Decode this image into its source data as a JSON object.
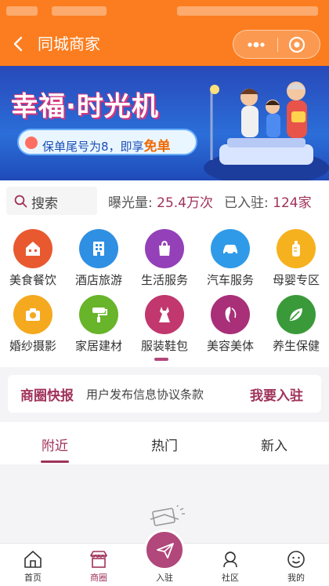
{
  "header": {
    "title": "同城商家",
    "background": "#fb7d1f"
  },
  "banner": {
    "title": "幸福·时光机",
    "subtitle_prefix": "保单尾号为8，即享",
    "subtitle_highlight": "免单"
  },
  "stats": {
    "search_label": "搜索",
    "exposure_label": "曝光量:",
    "exposure_value": "25.4万次",
    "joined_label": "已入驻:",
    "joined_value": "124家"
  },
  "categories": [
    {
      "label": "美食餐饮",
      "icon": "house-icon",
      "color": "#e8592f"
    },
    {
      "label": "酒店旅游",
      "icon": "hotel-icon",
      "color": "#2f8fe2"
    },
    {
      "label": "生活服务",
      "icon": "bag-icon",
      "color": "#9440b8"
    },
    {
      "label": "汽车服务",
      "icon": "car-icon",
      "color": "#2f9be8"
    },
    {
      "label": "母婴专区",
      "icon": "bottle-icon",
      "color": "#f5b21e"
    },
    {
      "label": "婚纱摄影",
      "icon": "camera-icon",
      "color": "#f5a91e"
    },
    {
      "label": "家居建材",
      "icon": "roller-icon",
      "color": "#68b42a"
    },
    {
      "label": "服装鞋包",
      "icon": "dress-icon",
      "color": "#c1376e"
    },
    {
      "label": "美容美体",
      "icon": "face-icon",
      "color": "#a82f78"
    },
    {
      "label": "养生保健",
      "icon": "leaf-icon",
      "color": "#3a9a3a"
    }
  ],
  "news": {
    "tag": "商圈快报",
    "text": "用户发布信息协议条款",
    "join": "我要入驻"
  },
  "tabs": [
    {
      "label": "附近"
    },
    {
      "label": "热门"
    },
    {
      "label": "新入"
    }
  ],
  "nav": {
    "home": "首页",
    "shop": "商圈",
    "post": "入驻",
    "community": "社区",
    "mine": "我的"
  },
  "accent": "#a0325a"
}
